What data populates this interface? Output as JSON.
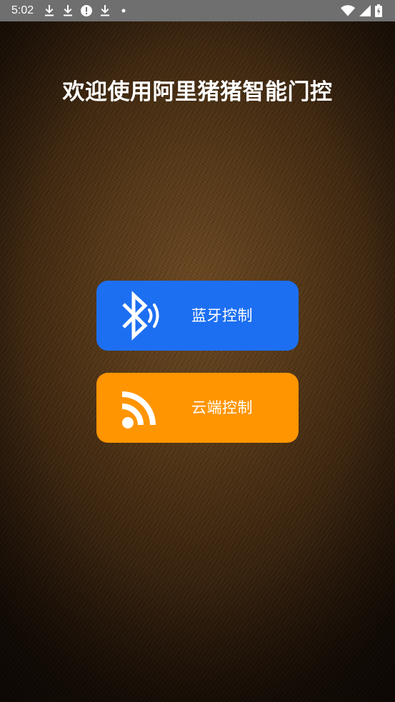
{
  "status_bar": {
    "time": "5:02",
    "notification_icons": [
      "download-icon",
      "download-icon",
      "alert-icon",
      "download-icon",
      "dot-icon"
    ],
    "system_icons": [
      "wifi-icon",
      "cell-signal-icon",
      "battery-icon"
    ],
    "background_color": "#6f6f6f"
  },
  "app": {
    "title": "欢迎使用阿里猪猪智能门控"
  },
  "buttons": {
    "bluetooth": {
      "label": "蓝牙控制",
      "icon": "bluetooth-icon",
      "color": "#1d6ff2"
    },
    "cloud": {
      "label": "云端控制",
      "icon": "rss-feed-icon",
      "color": "#ff9500"
    }
  }
}
